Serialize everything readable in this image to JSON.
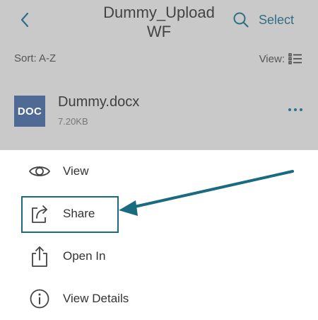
{
  "header": {
    "title": "Dummy_Upload WF",
    "select_label": "Select",
    "back_icon": "chevron-left-icon",
    "search_icon": "search-icon"
  },
  "toolbar": {
    "sort_label": "Sort: A-Z",
    "view_label": "View:",
    "view_icon": "list-view-icon"
  },
  "file": {
    "type_badge": "DOC",
    "name": "Dummy.docx",
    "size": "7.20KB",
    "more_icon": "more-horizontal-icon"
  },
  "menu": {
    "items": [
      {
        "label": "View",
        "icon": "eye-icon"
      },
      {
        "label": "Share",
        "icon": "share-icon"
      },
      {
        "label": "Open In",
        "icon": "upload-icon"
      },
      {
        "label": "View Details",
        "icon": "info-icon"
      }
    ]
  },
  "colors": {
    "accent": "#2f6f86",
    "dimmed_background": "#c9c9c9",
    "doc_badge": "#4f6b95",
    "annotation": "#1b6b80"
  }
}
